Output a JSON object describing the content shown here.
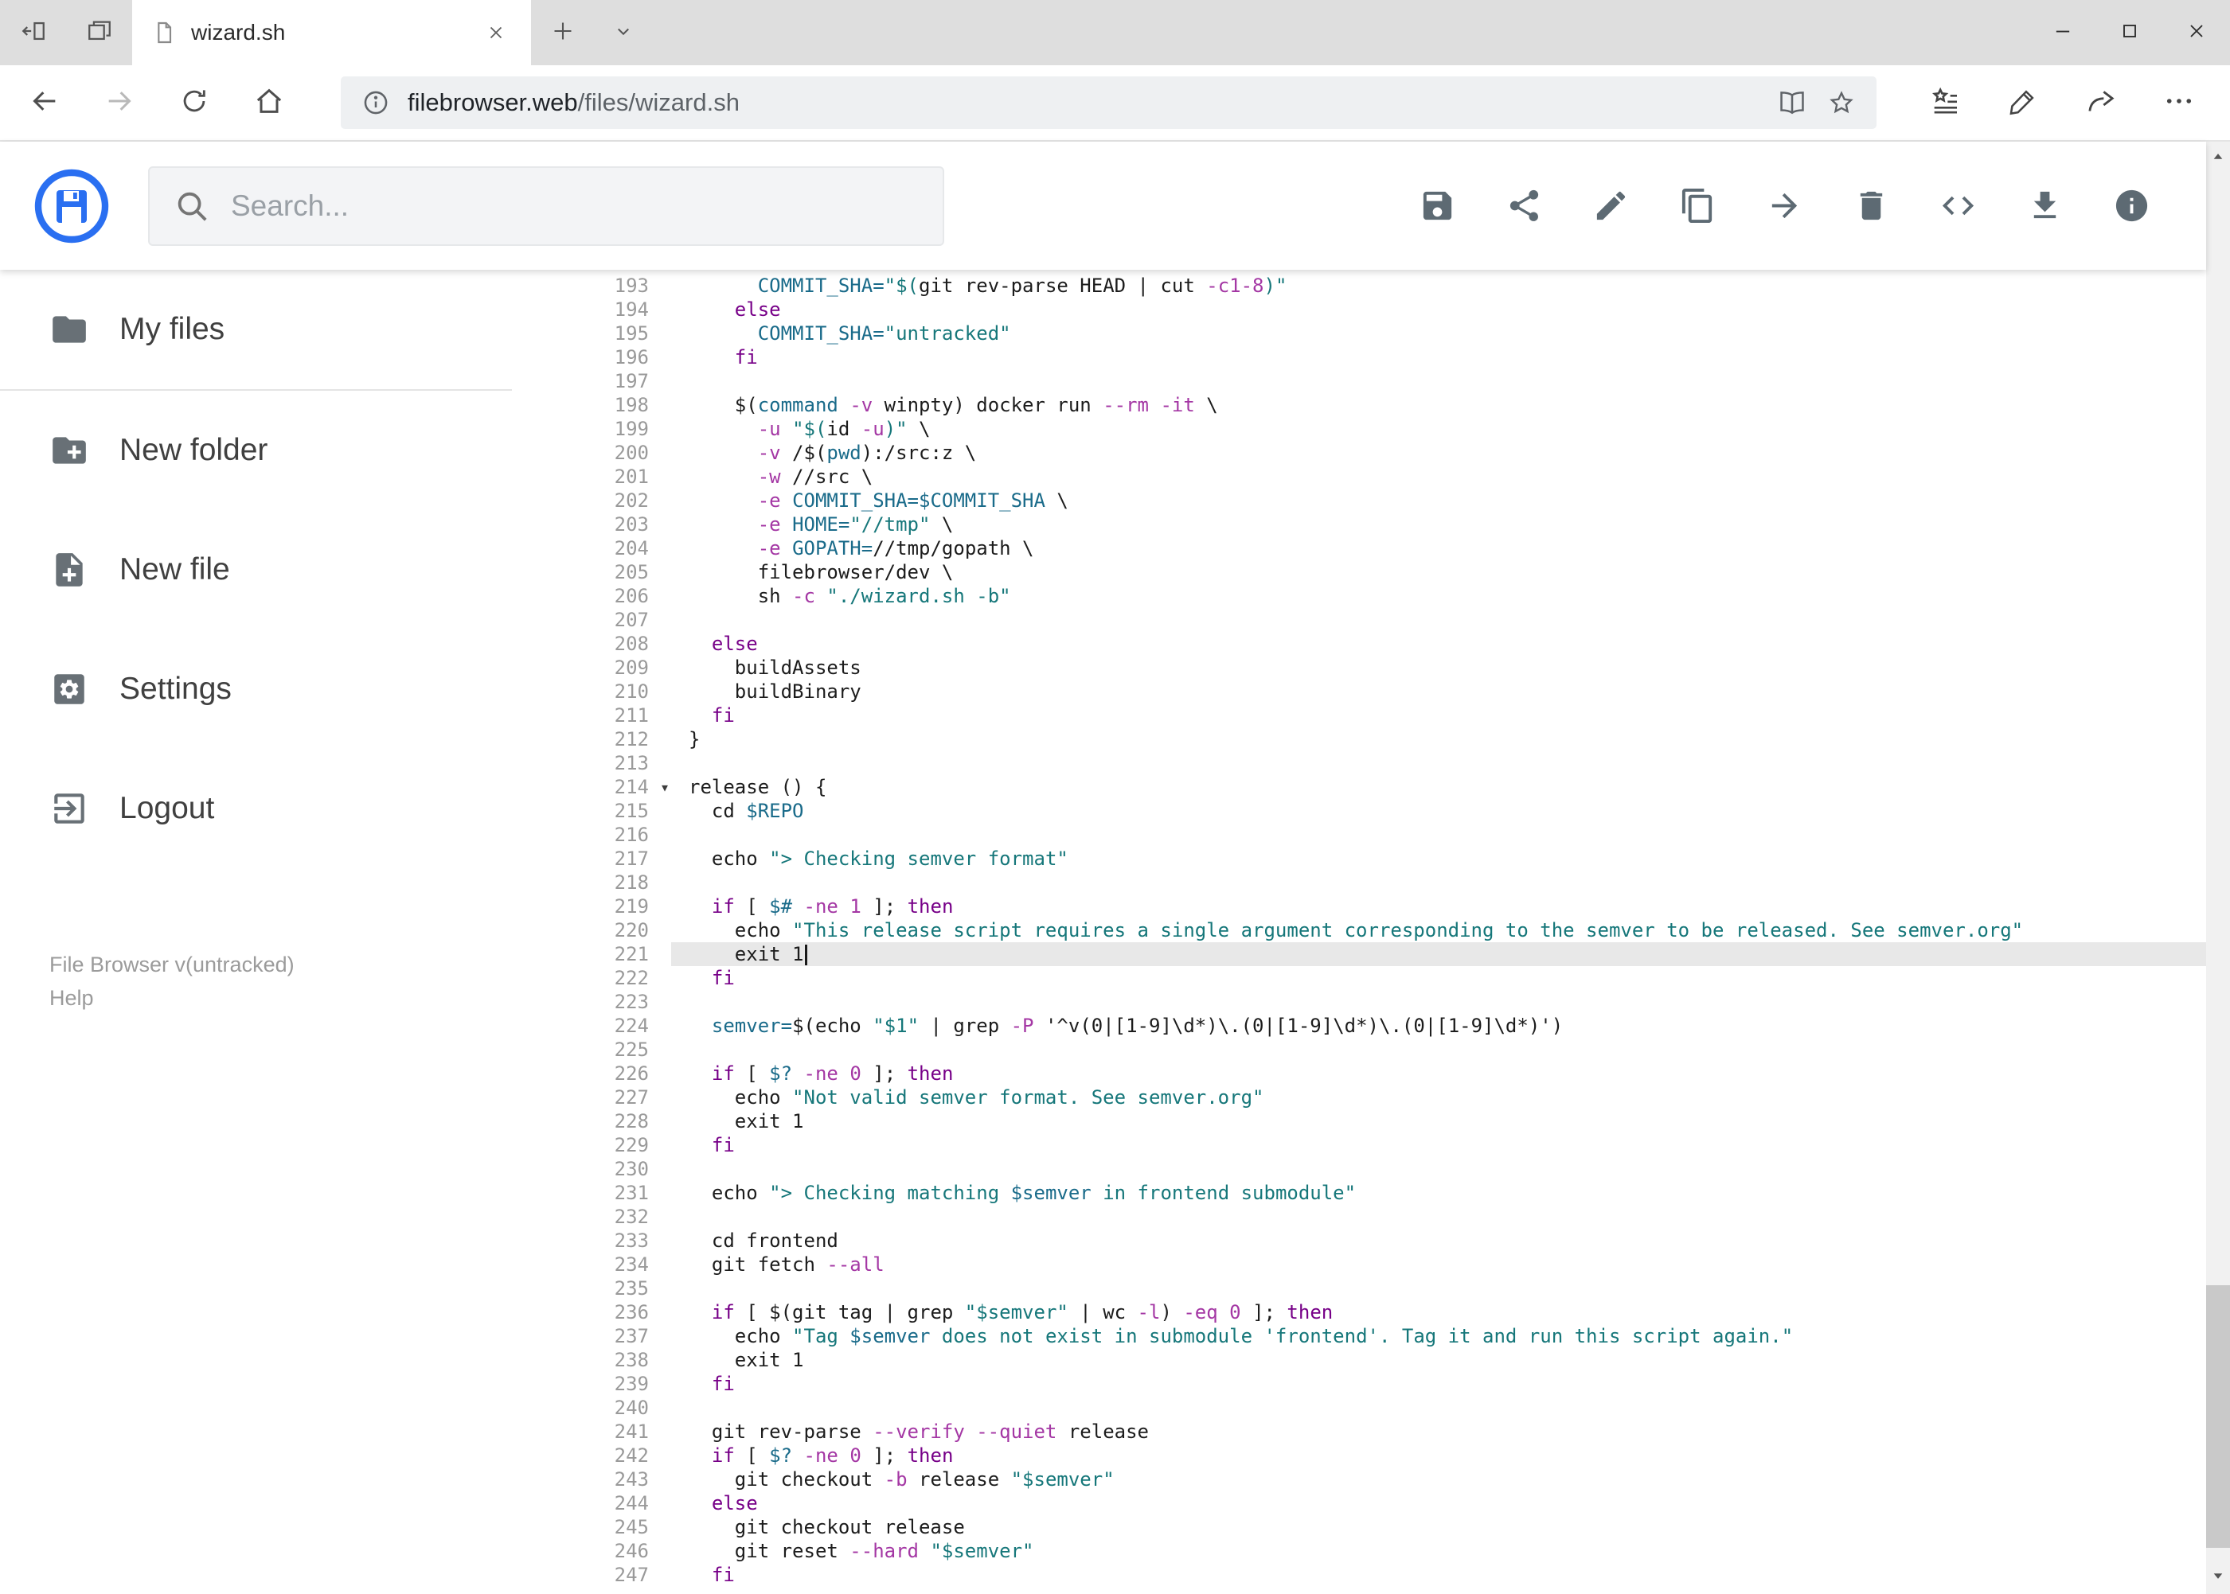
{
  "browser": {
    "tab": {
      "title": "wizard.sh"
    },
    "address": {
      "domain": "filebrowser.web",
      "path": "/files/wizard.sh"
    }
  },
  "app": {
    "search_placeholder": "Search...",
    "toolbar": [
      {
        "name": "save",
        "icon": "save-icon"
      },
      {
        "name": "share",
        "icon": "share-icon"
      },
      {
        "name": "edit",
        "icon": "edit-icon"
      },
      {
        "name": "copy",
        "icon": "copy-icon"
      },
      {
        "name": "move",
        "icon": "move-forward-icon"
      },
      {
        "name": "delete",
        "icon": "delete-icon"
      },
      {
        "name": "source",
        "icon": "code-icon"
      },
      {
        "name": "download",
        "icon": "download-icon"
      },
      {
        "name": "info",
        "icon": "info-icon"
      }
    ],
    "sidebar": {
      "items": [
        {
          "label": "My files",
          "icon": "folder-icon"
        },
        {
          "label": "New folder",
          "icon": "new-folder-icon"
        },
        {
          "label": "New file",
          "icon": "new-file-icon"
        },
        {
          "label": "Settings",
          "icon": "settings-icon"
        },
        {
          "label": "Logout",
          "icon": "logout-icon"
        }
      ],
      "footer_version": "File Browser v(untracked)",
      "footer_help": "Help"
    }
  },
  "editor": {
    "active_line": 221,
    "colors": {
      "keyword": "#770088",
      "string": "#16777a",
      "variable": "#1a6b8a",
      "attribute": "#a437a4",
      "number": "#a437a4",
      "plain": "#1c1c1c",
      "line_number": "#9a9a9a",
      "active_line_bg": "#e8e8e8",
      "accent": "#2a6ff1"
    },
    "lines": [
      {
        "n": 193,
        "t": [
          [
            "p",
            "      "
          ],
          [
            "v",
            "COMMIT_SHA="
          ],
          [
            "s",
            "\"$("
          ],
          [
            "p",
            "git rev-parse HEAD | cut "
          ],
          [
            "a",
            "-c1-8"
          ],
          [
            "s",
            ")\""
          ]
        ]
      },
      {
        "n": 194,
        "t": [
          [
            "p",
            "    "
          ],
          [
            "k",
            "else"
          ]
        ]
      },
      {
        "n": 195,
        "t": [
          [
            "p",
            "      "
          ],
          [
            "v",
            "COMMIT_SHA="
          ],
          [
            "s",
            "\"untracked\""
          ]
        ]
      },
      {
        "n": 196,
        "t": [
          [
            "p",
            "    "
          ],
          [
            "k",
            "fi"
          ]
        ]
      },
      {
        "n": 197,
        "t": []
      },
      {
        "n": 198,
        "t": [
          [
            "p",
            "    $("
          ],
          [
            "v",
            "command"
          ],
          [
            "p",
            " "
          ],
          [
            "a",
            "-v"
          ],
          [
            "p",
            " winpty) docker run "
          ],
          [
            "a",
            "--rm"
          ],
          [
            "p",
            " "
          ],
          [
            "a",
            "-it"
          ],
          [
            "p",
            " \\"
          ]
        ]
      },
      {
        "n": 199,
        "t": [
          [
            "p",
            "      "
          ],
          [
            "a",
            "-u"
          ],
          [
            "p",
            " "
          ],
          [
            "s",
            "\"$("
          ],
          [
            "p",
            "id "
          ],
          [
            "a",
            "-u"
          ],
          [
            "s",
            ")\""
          ],
          [
            "p",
            " \\"
          ]
        ]
      },
      {
        "n": 200,
        "t": [
          [
            "p",
            "      "
          ],
          [
            "a",
            "-v"
          ],
          [
            "p",
            " /$("
          ],
          [
            "v",
            "pwd"
          ],
          [
            "p",
            "):/src:z \\"
          ]
        ]
      },
      {
        "n": 201,
        "t": [
          [
            "p",
            "      "
          ],
          [
            "a",
            "-w"
          ],
          [
            "p",
            " //src \\"
          ]
        ]
      },
      {
        "n": 202,
        "t": [
          [
            "p",
            "      "
          ],
          [
            "a",
            "-e"
          ],
          [
            "p",
            " "
          ],
          [
            "v",
            "COMMIT_SHA=$COMMIT_SHA"
          ],
          [
            "p",
            " \\"
          ]
        ]
      },
      {
        "n": 203,
        "t": [
          [
            "p",
            "      "
          ],
          [
            "a",
            "-e"
          ],
          [
            "p",
            " "
          ],
          [
            "v",
            "HOME="
          ],
          [
            "s",
            "\"//tmp\""
          ],
          [
            "p",
            " \\"
          ]
        ]
      },
      {
        "n": 204,
        "t": [
          [
            "p",
            "      "
          ],
          [
            "a",
            "-e"
          ],
          [
            "p",
            " "
          ],
          [
            "v",
            "GOPATH="
          ],
          [
            "p",
            "//tmp/gopath \\"
          ]
        ]
      },
      {
        "n": 205,
        "t": [
          [
            "p",
            "      filebrowser/dev \\"
          ]
        ]
      },
      {
        "n": 206,
        "t": [
          [
            "p",
            "      sh "
          ],
          [
            "a",
            "-c"
          ],
          [
            "p",
            " "
          ],
          [
            "s",
            "\"./wizard.sh -b\""
          ]
        ]
      },
      {
        "n": 207,
        "t": []
      },
      {
        "n": 208,
        "t": [
          [
            "p",
            "  "
          ],
          [
            "k",
            "else"
          ]
        ]
      },
      {
        "n": 209,
        "t": [
          [
            "p",
            "    buildAssets"
          ]
        ]
      },
      {
        "n": 210,
        "t": [
          [
            "p",
            "    buildBinary"
          ]
        ]
      },
      {
        "n": 211,
        "t": [
          [
            "p",
            "  "
          ],
          [
            "k",
            "fi"
          ]
        ]
      },
      {
        "n": 212,
        "t": [
          [
            "p",
            "}"
          ]
        ]
      },
      {
        "n": 213,
        "t": []
      },
      {
        "n": 214,
        "fold": true,
        "t": [
          [
            "p",
            "release () {"
          ]
        ]
      },
      {
        "n": 215,
        "t": [
          [
            "p",
            "  cd "
          ],
          [
            "v",
            "$REPO"
          ]
        ]
      },
      {
        "n": 216,
        "t": []
      },
      {
        "n": 217,
        "t": [
          [
            "p",
            "  echo "
          ],
          [
            "s",
            "\"> Checking semver format\""
          ]
        ]
      },
      {
        "n": 218,
        "t": []
      },
      {
        "n": 219,
        "t": [
          [
            "p",
            "  "
          ],
          [
            "k",
            "if"
          ],
          [
            "p",
            " [ "
          ],
          [
            "v",
            "$#"
          ],
          [
            "p",
            " "
          ],
          [
            "a",
            "-ne"
          ],
          [
            "p",
            " "
          ],
          [
            "n",
            "1"
          ],
          [
            "p",
            " ]; "
          ],
          [
            "k",
            "then"
          ]
        ]
      },
      {
        "n": 220,
        "t": [
          [
            "p",
            "    echo "
          ],
          [
            "s",
            "\"This release script requires a single argument corresponding to the semver to be released. See semver.org\""
          ]
        ]
      },
      {
        "n": 221,
        "t": [
          [
            "p",
            "    exit 1"
          ]
        ]
      },
      {
        "n": 222,
        "t": [
          [
            "p",
            "  "
          ],
          [
            "k",
            "fi"
          ]
        ]
      },
      {
        "n": 223,
        "t": []
      },
      {
        "n": 224,
        "t": [
          [
            "p",
            "  "
          ],
          [
            "v",
            "semver="
          ],
          [
            "p",
            "$(echo "
          ],
          [
            "s",
            "\"$1\""
          ],
          [
            "p",
            " | grep "
          ],
          [
            "a",
            "-P"
          ],
          [
            "p",
            " '^v(0|[1-9]\\d*)\\.(0|[1-9]\\d*)\\.(0|[1-9]\\d*)')"
          ]
        ]
      },
      {
        "n": 225,
        "t": []
      },
      {
        "n": 226,
        "t": [
          [
            "p",
            "  "
          ],
          [
            "k",
            "if"
          ],
          [
            "p",
            " [ "
          ],
          [
            "v",
            "$?"
          ],
          [
            "p",
            " "
          ],
          [
            "a",
            "-ne"
          ],
          [
            "p",
            " "
          ],
          [
            "n",
            "0"
          ],
          [
            "p",
            " ]; "
          ],
          [
            "k",
            "then"
          ]
        ]
      },
      {
        "n": 227,
        "t": [
          [
            "p",
            "    echo "
          ],
          [
            "s",
            "\"Not valid semver format. See semver.org\""
          ]
        ]
      },
      {
        "n": 228,
        "t": [
          [
            "p",
            "    exit 1"
          ]
        ]
      },
      {
        "n": 229,
        "t": [
          [
            "p",
            "  "
          ],
          [
            "k",
            "fi"
          ]
        ]
      },
      {
        "n": 230,
        "t": []
      },
      {
        "n": 231,
        "t": [
          [
            "p",
            "  echo "
          ],
          [
            "s",
            "\"> Checking matching "
          ],
          [
            "v",
            "$semver"
          ],
          [
            "s",
            " in frontend submodule\""
          ]
        ]
      },
      {
        "n": 232,
        "t": []
      },
      {
        "n": 233,
        "t": [
          [
            "p",
            "  cd frontend"
          ]
        ]
      },
      {
        "n": 234,
        "t": [
          [
            "p",
            "  git fetch "
          ],
          [
            "a",
            "--all"
          ]
        ]
      },
      {
        "n": 235,
        "t": []
      },
      {
        "n": 236,
        "t": [
          [
            "p",
            "  "
          ],
          [
            "k",
            "if"
          ],
          [
            "p",
            " [ $(git tag | grep "
          ],
          [
            "s",
            "\"$semver\""
          ],
          [
            "p",
            " | wc "
          ],
          [
            "a",
            "-l"
          ],
          [
            "p",
            ") "
          ],
          [
            "a",
            "-eq"
          ],
          [
            "p",
            " "
          ],
          [
            "n",
            "0"
          ],
          [
            "p",
            " ]; "
          ],
          [
            "k",
            "then"
          ]
        ]
      },
      {
        "n": 237,
        "t": [
          [
            "p",
            "    echo "
          ],
          [
            "s",
            "\"Tag "
          ],
          [
            "v",
            "$semver"
          ],
          [
            "s",
            " does not exist in submodule 'frontend'. Tag it and run this script again.\""
          ]
        ]
      },
      {
        "n": 238,
        "t": [
          [
            "p",
            "    exit 1"
          ]
        ]
      },
      {
        "n": 239,
        "t": [
          [
            "p",
            "  "
          ],
          [
            "k",
            "fi"
          ]
        ]
      },
      {
        "n": 240,
        "t": []
      },
      {
        "n": 241,
        "t": [
          [
            "p",
            "  git rev-parse "
          ],
          [
            "a",
            "--verify"
          ],
          [
            "p",
            " "
          ],
          [
            "a",
            "--quiet"
          ],
          [
            "p",
            " release"
          ]
        ]
      },
      {
        "n": 242,
        "t": [
          [
            "p",
            "  "
          ],
          [
            "k",
            "if"
          ],
          [
            "p",
            " [ "
          ],
          [
            "v",
            "$?"
          ],
          [
            "p",
            " "
          ],
          [
            "a",
            "-ne"
          ],
          [
            "p",
            " "
          ],
          [
            "n",
            "0"
          ],
          [
            "p",
            " ]; "
          ],
          [
            "k",
            "then"
          ]
        ]
      },
      {
        "n": 243,
        "t": [
          [
            "p",
            "    git checkout "
          ],
          [
            "a",
            "-b"
          ],
          [
            "p",
            " release "
          ],
          [
            "s",
            "\"$semver\""
          ]
        ]
      },
      {
        "n": 244,
        "t": [
          [
            "p",
            "  "
          ],
          [
            "k",
            "else"
          ]
        ]
      },
      {
        "n": 245,
        "t": [
          [
            "p",
            "    git checkout release"
          ]
        ]
      },
      {
        "n": 246,
        "t": [
          [
            "p",
            "    git reset "
          ],
          [
            "a",
            "--hard"
          ],
          [
            "p",
            " "
          ],
          [
            "s",
            "\"$semver\""
          ]
        ]
      },
      {
        "n": 247,
        "t": [
          [
            "p",
            "  "
          ],
          [
            "k",
            "fi"
          ]
        ]
      }
    ]
  }
}
